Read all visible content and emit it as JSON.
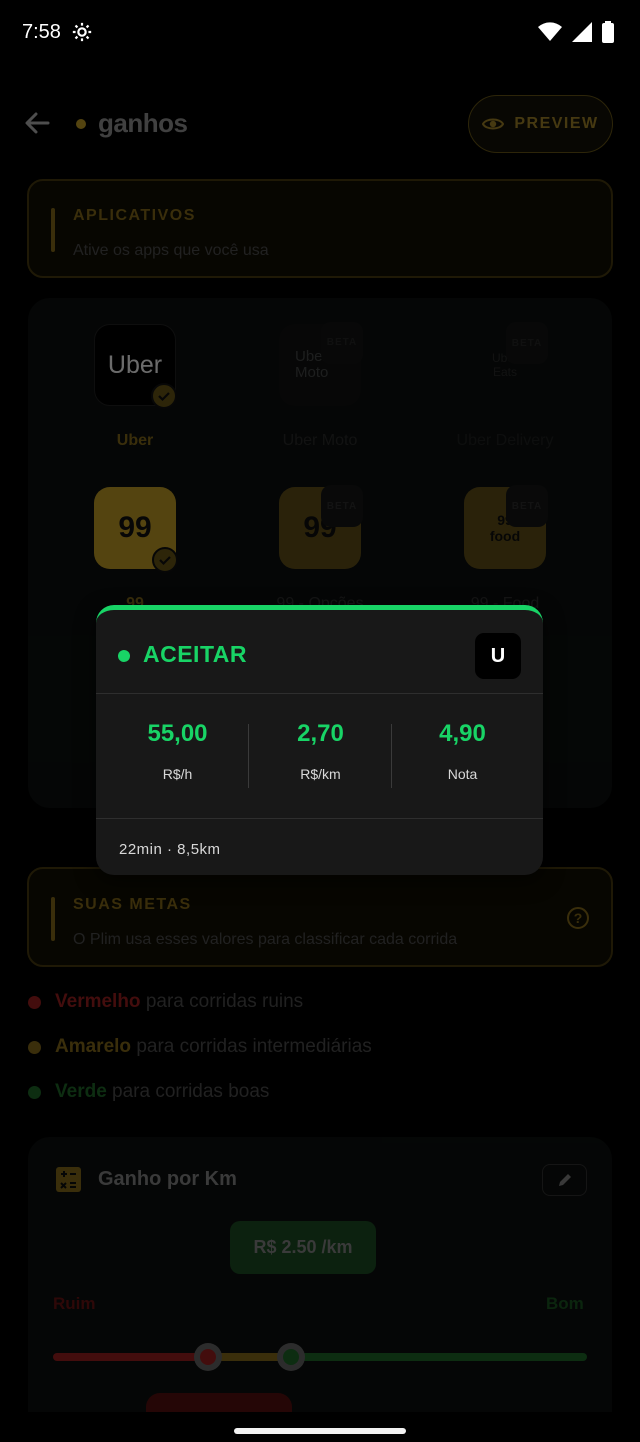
{
  "status_bar": {
    "time": "7:58",
    "icons": [
      "settings-gear-icon",
      "wifi-icon",
      "signal-icon",
      "battery-icon"
    ]
  },
  "header": {
    "title": "ganhos",
    "preview_label": "PREVIEW"
  },
  "apps_section": {
    "title": "APLICATIVOS",
    "subtitle": "Ative os apps que você usa"
  },
  "apps": [
    {
      "label": "Uber",
      "tile_text": "Uber",
      "active": true,
      "beta": false
    },
    {
      "label": "Uber Moto",
      "tile_text": "Uber Moto",
      "active": false,
      "beta": true
    },
    {
      "label": "Uber Delivery",
      "tile_text": "Uber Eats",
      "active": false,
      "beta": true
    },
    {
      "label": "99",
      "tile_text": "99",
      "active": true,
      "beta": false
    },
    {
      "label": "99 - Opções",
      "tile_text": "99",
      "active": false,
      "beta": true
    },
    {
      "label": "99 - Food",
      "tile_text": "99 food",
      "active": false,
      "beta": true
    }
  ],
  "beta_label": "BETA",
  "popup": {
    "status": "ACEITAR",
    "app_badge": "U",
    "stats": [
      {
        "value": "55,00",
        "label": "R$/h"
      },
      {
        "value": "2,70",
        "label": "R$/km"
      },
      {
        "value": "4,90",
        "label": "Nota"
      }
    ],
    "trip_info": "22min · 8,5km"
  },
  "goals_section": {
    "title": "SUAS METAS",
    "subtitle": "O Plim usa esses valores para classificar cada corrida"
  },
  "legend": [
    {
      "color_name": "Vermelho",
      "text": "para corridas ruins",
      "color": "#a11f1f"
    },
    {
      "color_name": "Amarelo",
      "text": "para corridas intermediárias",
      "color": "#8a6f1c"
    },
    {
      "color_name": "Verde",
      "text": "para corridas boas",
      "color": "#1f6b2a"
    }
  ],
  "km_card": {
    "title": "Ganho por Km",
    "value_pill": "R$ 2.50 /km",
    "low_label": "Ruim",
    "high_label": "Bom",
    "threshold_low_fraction": 0.29,
    "threshold_high_fraction": 0.445
  },
  "colors": {
    "accent_green": "#18d466",
    "gold": "#c9a227"
  }
}
